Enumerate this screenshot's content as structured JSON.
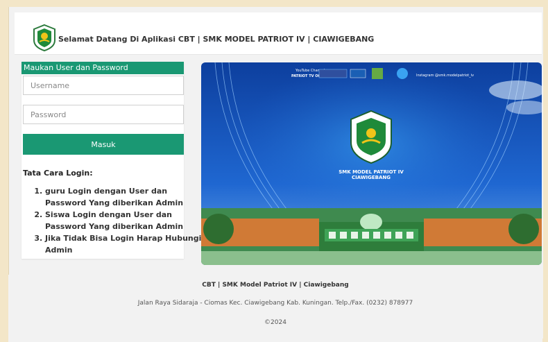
{
  "header": {
    "title": "Selamat Datang Di Aplikasi CBT | SMK MODEL PATRIOT IV | CIAWIGEBANG"
  },
  "login": {
    "header": "Maukan User dan Password",
    "username_placeholder": "Username",
    "password_placeholder": "Password",
    "submit_label": "Masuk"
  },
  "guide": {
    "title": "Tata Cara Login:",
    "items": [
      "guru Login dengan User dan Password Yang diberikan Admin",
      "Siswa Login dengan User dan Password Yang diberikan Admin",
      "Jika Tidak Bisa Login Harap Hubungi Admin"
    ]
  },
  "banner": {
    "youtube_line1": "YouTube Channel",
    "youtube_line2": "PATRIOT TV Official",
    "instagram": "Instagram @smk.modelpatriot_iv",
    "school_line1": "SMK MODEL PATRIOT IV",
    "school_line2": "CIAWIGEBANG"
  },
  "footer": {
    "line1": "CBT | SMK Model Patriot IV | Ciawigebang",
    "line2": "Jalan Raya Sidaraja - Ciomas Kec. Ciawigebang Kab. Kuningan. Telp./Fax. (0232) 878977",
    "line3": "©2024"
  },
  "colors": {
    "primary": "#1a9873",
    "banner_blue": "#1e5ac8"
  }
}
